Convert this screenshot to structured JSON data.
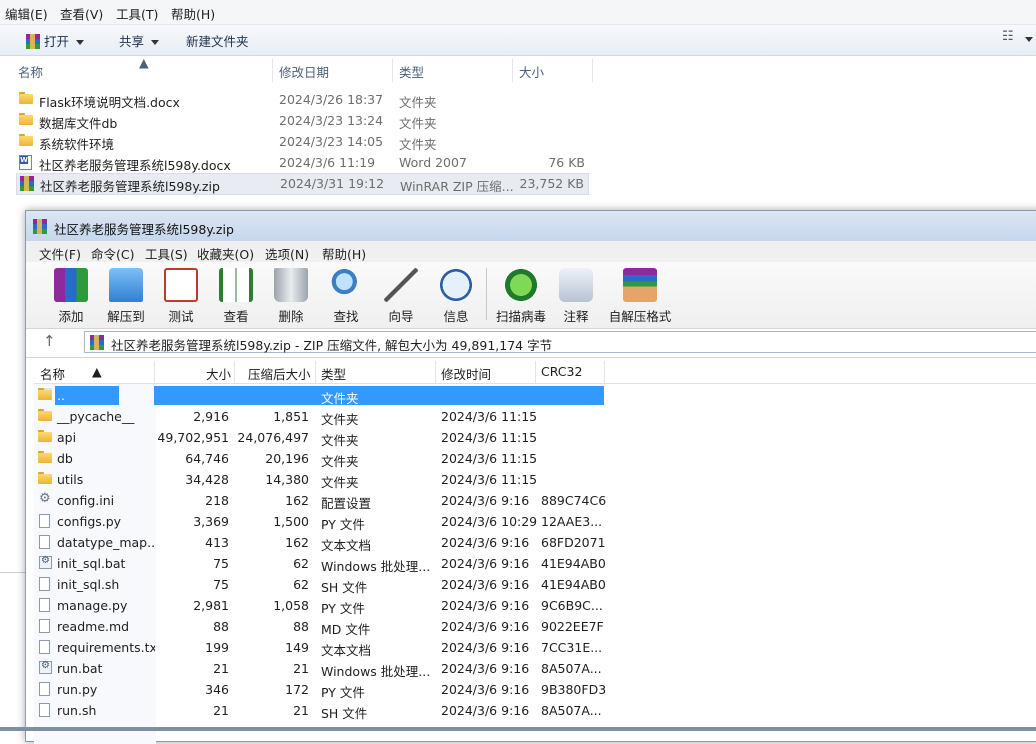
{
  "explorer": {
    "menu": [
      "编辑(E)",
      "查看(V)",
      "工具(T)",
      "帮助(H)"
    ],
    "toolbar": {
      "open": "打开",
      "share": "共享",
      "new_folder": "新建文件夹"
    },
    "columns": {
      "name": "名称",
      "date": "修改日期",
      "type": "类型",
      "size": "大小"
    },
    "rows": [
      {
        "icon": "folder-icon",
        "name": "Flask环境说明文档.docx",
        "date": "2024/3/26 18:37",
        "type": "文件夹",
        "size": ""
      },
      {
        "icon": "folder-icon",
        "name": "数据库文件db",
        "date": "2024/3/23 13:24",
        "type": "文件夹",
        "size": ""
      },
      {
        "icon": "folder-icon",
        "name": "系统软件环境",
        "date": "2024/3/23 14:05",
        "type": "文件夹",
        "size": ""
      },
      {
        "icon": "word-doc-icon",
        "name": "社区养老服务管理系统l598y.docx",
        "date": "2024/3/6 11:19",
        "type": "Word 2007",
        "size": "76 KB"
      },
      {
        "icon": "rar-archive-icon",
        "name": "社区养老服务管理系统l598y.zip",
        "date": "2024/3/31 19:12",
        "type": "WinRAR ZIP 压缩...",
        "size": "23,752 KB"
      }
    ]
  },
  "winrar": {
    "title": "社区养老服务管理系统l598y.zip",
    "menu": [
      "文件(F)",
      "命令(C)",
      "工具(S)",
      "收藏夹(O)",
      "选项(N)",
      "帮助(H)"
    ],
    "tools": [
      "添加",
      "解压到",
      "测试",
      "查看",
      "删除",
      "查找",
      "向导",
      "信息",
      "扫描病毒",
      "注释",
      "自解压格式"
    ],
    "address": "社区养老服务管理系统l598y.zip - ZIP 压缩文件, 解包大小为 49,891,174 字节",
    "columns": {
      "name": "名称",
      "size": "大小",
      "packed": "压缩后大小",
      "type": "类型",
      "modified": "修改时间",
      "crc": "CRC32"
    },
    "rows": [
      {
        "icon": "folder-icon",
        "name": "..",
        "size": "",
        "packed": "",
        "type": "文件夹",
        "modified": "",
        "crc": ""
      },
      {
        "icon": "folder-icon",
        "name": "__pycache__",
        "size": "2,916",
        "packed": "1,851",
        "type": "文件夹",
        "modified": "2024/3/6 11:15",
        "crc": ""
      },
      {
        "icon": "folder-icon",
        "name": "api",
        "size": "49,702,951",
        "packed": "24,076,497",
        "type": "文件夹",
        "modified": "2024/3/6 11:15",
        "crc": ""
      },
      {
        "icon": "folder-icon",
        "name": "db",
        "size": "64,746",
        "packed": "20,196",
        "type": "文件夹",
        "modified": "2024/3/6 11:15",
        "crc": ""
      },
      {
        "icon": "folder-icon",
        "name": "utils",
        "size": "34,428",
        "packed": "14,380",
        "type": "文件夹",
        "modified": "2024/3/6 11:15",
        "crc": ""
      },
      {
        "icon": "settings-file-icon",
        "name": "config.ini",
        "size": "218",
        "packed": "162",
        "type": "配置设置",
        "modified": "2024/3/6 9:16",
        "crc": "889C74C6"
      },
      {
        "icon": "file-icon",
        "name": "configs.py",
        "size": "3,369",
        "packed": "1,500",
        "type": "PY 文件",
        "modified": "2024/3/6 10:29",
        "crc": "12AAE3..."
      },
      {
        "icon": "file-icon",
        "name": "datatype_map....",
        "size": "413",
        "packed": "162",
        "type": "文本文档",
        "modified": "2024/3/6 9:16",
        "crc": "68FD2071"
      },
      {
        "icon": "batch-file-icon",
        "name": "init_sql.bat",
        "size": "75",
        "packed": "62",
        "type": "Windows 批处理...",
        "modified": "2024/3/6 9:16",
        "crc": "41E94AB0"
      },
      {
        "icon": "file-icon",
        "name": "init_sql.sh",
        "size": "75",
        "packed": "62",
        "type": "SH 文件",
        "modified": "2024/3/6 9:16",
        "crc": "41E94AB0"
      },
      {
        "icon": "file-icon",
        "name": "manage.py",
        "size": "2,981",
        "packed": "1,058",
        "type": "PY 文件",
        "modified": "2024/3/6 9:16",
        "crc": "9C6B9C..."
      },
      {
        "icon": "file-icon",
        "name": "readme.md",
        "size": "88",
        "packed": "88",
        "type": "MD 文件",
        "modified": "2024/3/6 9:16",
        "crc": "9022EE7F"
      },
      {
        "icon": "file-icon",
        "name": "requirements.txt",
        "size": "199",
        "packed": "149",
        "type": "文本文档",
        "modified": "2024/3/6 9:16",
        "crc": "7CC31E..."
      },
      {
        "icon": "batch-file-icon",
        "name": "run.bat",
        "size": "21",
        "packed": "21",
        "type": "Windows 批处理...",
        "modified": "2024/3/6 9:16",
        "crc": "8A507A..."
      },
      {
        "icon": "file-icon",
        "name": "run.py",
        "size": "346",
        "packed": "172",
        "type": "PY 文件",
        "modified": "2024/3/6 9:16",
        "crc": "9B380FD3"
      },
      {
        "icon": "file-icon",
        "name": "run.sh",
        "size": "21",
        "packed": "21",
        "type": "SH 文件",
        "modified": "2024/3/6 9:16",
        "crc": "8A507A..."
      }
    ]
  }
}
